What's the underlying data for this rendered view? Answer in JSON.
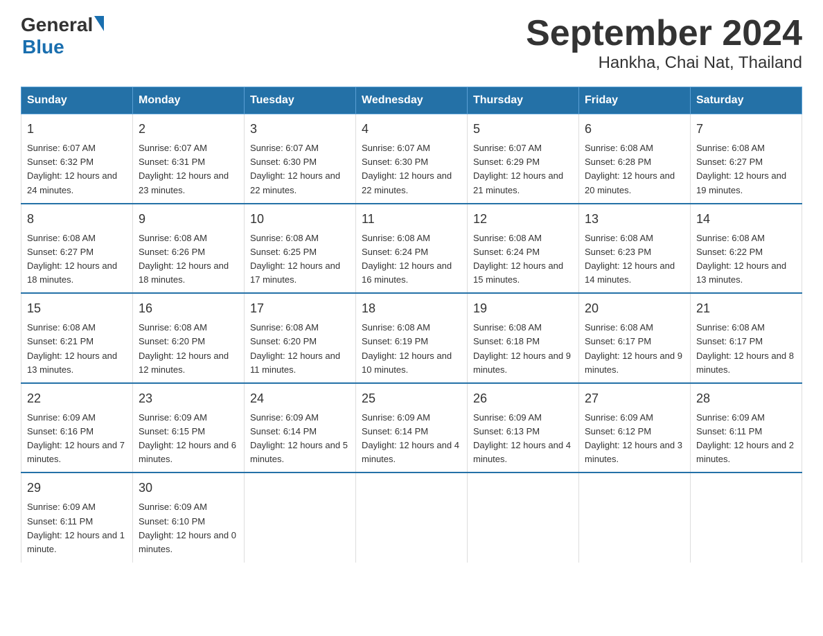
{
  "logo": {
    "general": "General",
    "blue": "Blue"
  },
  "title": "September 2024",
  "subtitle": "Hankha, Chai Nat, Thailand",
  "days_header": [
    "Sunday",
    "Monday",
    "Tuesday",
    "Wednesday",
    "Thursday",
    "Friday",
    "Saturday"
  ],
  "weeks": [
    [
      {
        "day": "1",
        "sunrise": "Sunrise: 6:07 AM",
        "sunset": "Sunset: 6:32 PM",
        "daylight": "Daylight: 12 hours and 24 minutes."
      },
      {
        "day": "2",
        "sunrise": "Sunrise: 6:07 AM",
        "sunset": "Sunset: 6:31 PM",
        "daylight": "Daylight: 12 hours and 23 minutes."
      },
      {
        "day": "3",
        "sunrise": "Sunrise: 6:07 AM",
        "sunset": "Sunset: 6:30 PM",
        "daylight": "Daylight: 12 hours and 22 minutes."
      },
      {
        "day": "4",
        "sunrise": "Sunrise: 6:07 AM",
        "sunset": "Sunset: 6:30 PM",
        "daylight": "Daylight: 12 hours and 22 minutes."
      },
      {
        "day": "5",
        "sunrise": "Sunrise: 6:07 AM",
        "sunset": "Sunset: 6:29 PM",
        "daylight": "Daylight: 12 hours and 21 minutes."
      },
      {
        "day": "6",
        "sunrise": "Sunrise: 6:08 AM",
        "sunset": "Sunset: 6:28 PM",
        "daylight": "Daylight: 12 hours and 20 minutes."
      },
      {
        "day": "7",
        "sunrise": "Sunrise: 6:08 AM",
        "sunset": "Sunset: 6:27 PM",
        "daylight": "Daylight: 12 hours and 19 minutes."
      }
    ],
    [
      {
        "day": "8",
        "sunrise": "Sunrise: 6:08 AM",
        "sunset": "Sunset: 6:27 PM",
        "daylight": "Daylight: 12 hours and 18 minutes."
      },
      {
        "day": "9",
        "sunrise": "Sunrise: 6:08 AM",
        "sunset": "Sunset: 6:26 PM",
        "daylight": "Daylight: 12 hours and 18 minutes."
      },
      {
        "day": "10",
        "sunrise": "Sunrise: 6:08 AM",
        "sunset": "Sunset: 6:25 PM",
        "daylight": "Daylight: 12 hours and 17 minutes."
      },
      {
        "day": "11",
        "sunrise": "Sunrise: 6:08 AM",
        "sunset": "Sunset: 6:24 PM",
        "daylight": "Daylight: 12 hours and 16 minutes."
      },
      {
        "day": "12",
        "sunrise": "Sunrise: 6:08 AM",
        "sunset": "Sunset: 6:24 PM",
        "daylight": "Daylight: 12 hours and 15 minutes."
      },
      {
        "day": "13",
        "sunrise": "Sunrise: 6:08 AM",
        "sunset": "Sunset: 6:23 PM",
        "daylight": "Daylight: 12 hours and 14 minutes."
      },
      {
        "day": "14",
        "sunrise": "Sunrise: 6:08 AM",
        "sunset": "Sunset: 6:22 PM",
        "daylight": "Daylight: 12 hours and 13 minutes."
      }
    ],
    [
      {
        "day": "15",
        "sunrise": "Sunrise: 6:08 AM",
        "sunset": "Sunset: 6:21 PM",
        "daylight": "Daylight: 12 hours and 13 minutes."
      },
      {
        "day": "16",
        "sunrise": "Sunrise: 6:08 AM",
        "sunset": "Sunset: 6:20 PM",
        "daylight": "Daylight: 12 hours and 12 minutes."
      },
      {
        "day": "17",
        "sunrise": "Sunrise: 6:08 AM",
        "sunset": "Sunset: 6:20 PM",
        "daylight": "Daylight: 12 hours and 11 minutes."
      },
      {
        "day": "18",
        "sunrise": "Sunrise: 6:08 AM",
        "sunset": "Sunset: 6:19 PM",
        "daylight": "Daylight: 12 hours and 10 minutes."
      },
      {
        "day": "19",
        "sunrise": "Sunrise: 6:08 AM",
        "sunset": "Sunset: 6:18 PM",
        "daylight": "Daylight: 12 hours and 9 minutes."
      },
      {
        "day": "20",
        "sunrise": "Sunrise: 6:08 AM",
        "sunset": "Sunset: 6:17 PM",
        "daylight": "Daylight: 12 hours and 9 minutes."
      },
      {
        "day": "21",
        "sunrise": "Sunrise: 6:08 AM",
        "sunset": "Sunset: 6:17 PM",
        "daylight": "Daylight: 12 hours and 8 minutes."
      }
    ],
    [
      {
        "day": "22",
        "sunrise": "Sunrise: 6:09 AM",
        "sunset": "Sunset: 6:16 PM",
        "daylight": "Daylight: 12 hours and 7 minutes."
      },
      {
        "day": "23",
        "sunrise": "Sunrise: 6:09 AM",
        "sunset": "Sunset: 6:15 PM",
        "daylight": "Daylight: 12 hours and 6 minutes."
      },
      {
        "day": "24",
        "sunrise": "Sunrise: 6:09 AM",
        "sunset": "Sunset: 6:14 PM",
        "daylight": "Daylight: 12 hours and 5 minutes."
      },
      {
        "day": "25",
        "sunrise": "Sunrise: 6:09 AM",
        "sunset": "Sunset: 6:14 PM",
        "daylight": "Daylight: 12 hours and 4 minutes."
      },
      {
        "day": "26",
        "sunrise": "Sunrise: 6:09 AM",
        "sunset": "Sunset: 6:13 PM",
        "daylight": "Daylight: 12 hours and 4 minutes."
      },
      {
        "day": "27",
        "sunrise": "Sunrise: 6:09 AM",
        "sunset": "Sunset: 6:12 PM",
        "daylight": "Daylight: 12 hours and 3 minutes."
      },
      {
        "day": "28",
        "sunrise": "Sunrise: 6:09 AM",
        "sunset": "Sunset: 6:11 PM",
        "daylight": "Daylight: 12 hours and 2 minutes."
      }
    ],
    [
      {
        "day": "29",
        "sunrise": "Sunrise: 6:09 AM",
        "sunset": "Sunset: 6:11 PM",
        "daylight": "Daylight: 12 hours and 1 minute."
      },
      {
        "day": "30",
        "sunrise": "Sunrise: 6:09 AM",
        "sunset": "Sunset: 6:10 PM",
        "daylight": "Daylight: 12 hours and 0 minutes."
      },
      null,
      null,
      null,
      null,
      null
    ]
  ]
}
